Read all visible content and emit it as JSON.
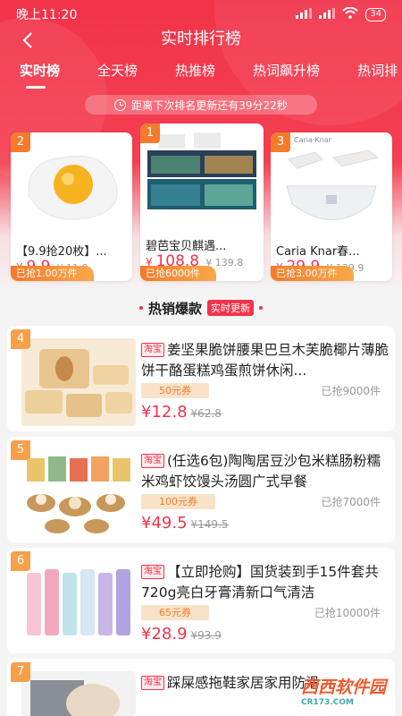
{
  "status_bar": {
    "time": "晚上11:20",
    "battery": "34"
  },
  "header": {
    "title": "实时排行榜"
  },
  "tabs": [
    "实时榜",
    "全天榜",
    "热推榜",
    "热词飙升榜",
    "热词排"
  ],
  "timer_text": "距离下次排名更新还有39分22秒",
  "top3": [
    {
      "rank": "2",
      "name": "【9.9抢20枚】...",
      "price": "9.9",
      "orig": "¥ 11.9",
      "sold": "已抢1.00万件"
    },
    {
      "rank": "1",
      "name": "碧芭宝贝麒遇...",
      "price": "108.8",
      "orig": "¥ 139.8",
      "sold": "已抢6000件"
    },
    {
      "rank": "3",
      "name": "Caria Knar春...",
      "price": "29.9",
      "orig": "¥ 139.9",
      "sold": "已抢3.00万件",
      "img_text": "Caria Knar"
    }
  ],
  "hot_section": {
    "title": "热销爆款",
    "badge": "实时更新"
  },
  "items": [
    {
      "rank": "4",
      "tag": "淘宝",
      "title": "姜坚果脆饼腰果巴旦木芙脆椰片薄脆饼干酪蛋糕鸡蛋煎饼休闲...",
      "coupon": "50元券",
      "grabbed": "已抢9000件",
      "price": "¥12.8",
      "orig": "¥62.8"
    },
    {
      "rank": "5",
      "tag": "淘宝",
      "title": "(任选6包)陶陶居豆沙包米糕肠粉糯米鸡虾饺馒头汤圆广式早餐",
      "coupon": "100元券",
      "grabbed": "已抢7000件",
      "price": "¥49.5",
      "orig": "¥149.5"
    },
    {
      "rank": "6",
      "tag": "淘宝",
      "title": "【立即抢购】国货装到手15件套共720g亮白牙膏清新口气清洁",
      "coupon": "65元券",
      "grabbed": "已抢10000件",
      "price": "¥28.9",
      "orig": "¥93.9"
    },
    {
      "rank": "7",
      "tag": "淘宝",
      "title": "踩屎感拖鞋家居家用防滑...",
      "coupon": "",
      "grabbed": "",
      "price": "",
      "orig": ""
    }
  ],
  "watermark": {
    "text": "西西软件园",
    "sub": "CR173.COM"
  },
  "colors": {
    "primary": "#f2334a",
    "badge_orange": "#f57a2a",
    "coupon_bg": "#f8e3c8"
  }
}
